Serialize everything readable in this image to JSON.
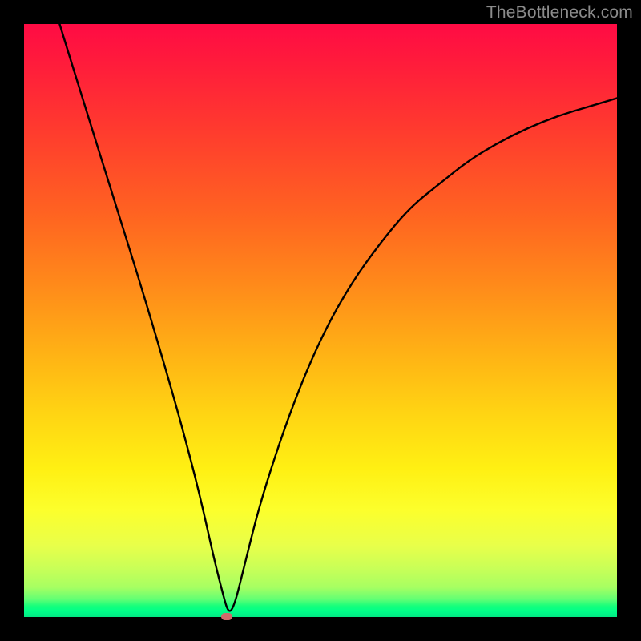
{
  "watermark": "TheBottleneck.com",
  "chart_data": {
    "type": "line",
    "title": "",
    "xlabel": "",
    "ylabel": "",
    "xlim": [
      0,
      100
    ],
    "ylim": [
      0,
      100
    ],
    "grid": false,
    "legend": false,
    "series": [
      {
        "name": "bottleneck-curve",
        "x": [
          6,
          10,
          15,
          20,
          25,
          28,
          30,
          32,
          33.5,
          34.5,
          35.5,
          37,
          40,
          45,
          50,
          55,
          60,
          65,
          70,
          75,
          80,
          85,
          90,
          95,
          100
        ],
        "y": [
          100,
          87,
          71,
          55,
          38,
          27,
          19,
          10,
          4,
          0.5,
          2,
          8,
          20,
          35,
          47,
          56,
          63,
          69,
          73,
          77,
          80,
          82.5,
          84.5,
          86,
          87.5
        ]
      }
    ],
    "marker": {
      "x": 34.2,
      "y": 0.2,
      "color": "#d16a6a"
    },
    "background_gradient": {
      "top": "#ff0b44",
      "mid": "#fff013",
      "bottom": "#02e884"
    }
  }
}
